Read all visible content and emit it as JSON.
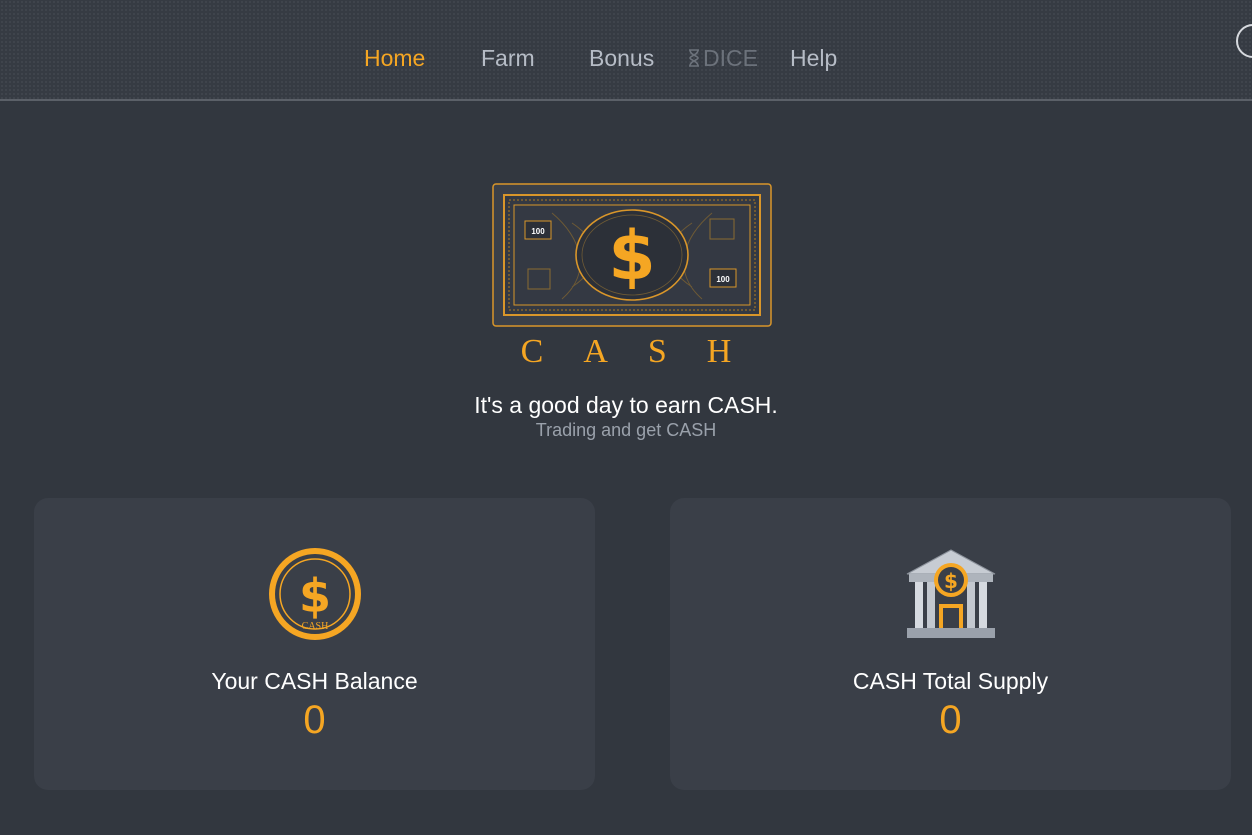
{
  "nav": {
    "items": [
      {
        "label": "Home",
        "active": true
      },
      {
        "label": "Farm",
        "active": false
      },
      {
        "label": "Bonus",
        "active": false
      },
      {
        "label": "DICE",
        "active": false,
        "disabled": true,
        "icon": "hourglass-icon"
      },
      {
        "label": "Help",
        "active": false
      }
    ]
  },
  "hero": {
    "banknote": {
      "denomination_left": "100",
      "denomination_right": "100"
    },
    "brand": "CASH",
    "tagline": "It's a good day to earn CASH.",
    "subtagline": "Trading and get CASH"
  },
  "cards": {
    "balance": {
      "icon": "cash-coin-icon",
      "coin_text": "CASH",
      "label": "Your CASH Balance",
      "value": "0"
    },
    "supply": {
      "icon": "bank-building-icon",
      "label": "CASH Total Supply",
      "value": "0"
    }
  },
  "colors": {
    "accent": "#f5a623",
    "background": "#32373f",
    "card": "#3a3f48",
    "nav_text": "#b6bcc6"
  }
}
